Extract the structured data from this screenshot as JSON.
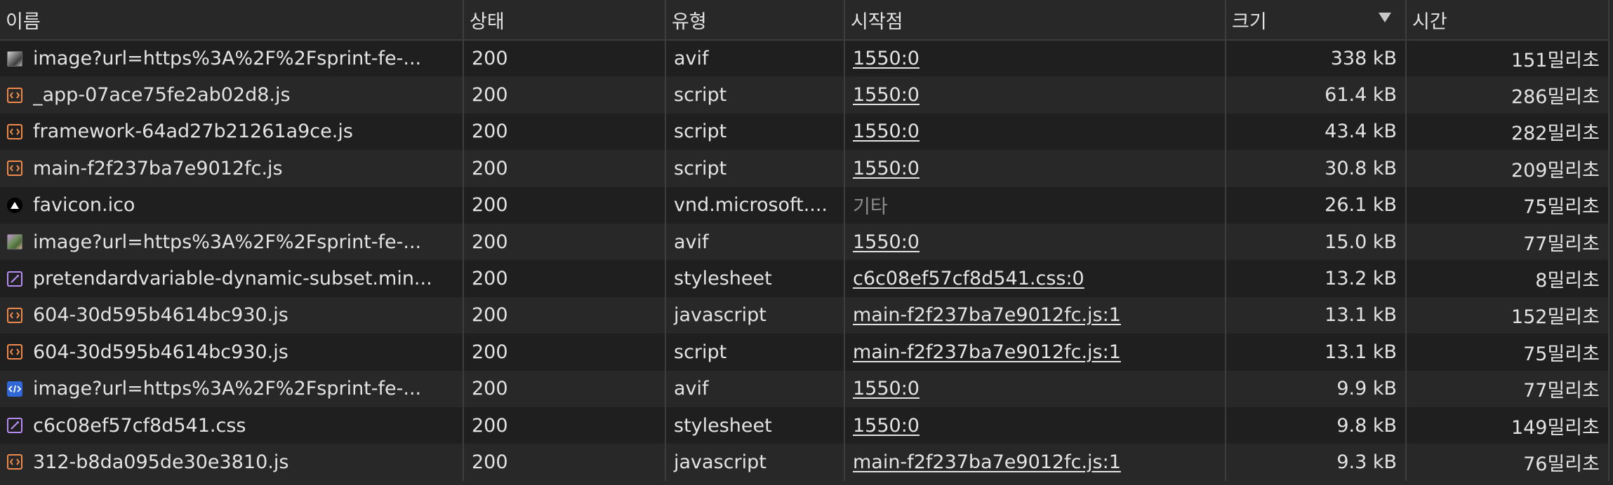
{
  "columns": {
    "name": "이름",
    "status": "상태",
    "type": "유형",
    "initiator": "시작점",
    "size": "크기",
    "time": "시간"
  },
  "sort": {
    "column": "size",
    "direction": "descending"
  },
  "rows": [
    {
      "icon": "image-thumbnail-icon",
      "name": "image?url=https%3A%2F%2Fsprint-fe-...",
      "status": "200",
      "type": "avif",
      "initiator": "1550:0",
      "initiator_link": true,
      "size": "338 kB",
      "time": "151밀리초"
    },
    {
      "icon": "script-file-icon",
      "name": "_app-07ace75fe2ab02d8.js",
      "status": "200",
      "type": "script",
      "initiator": "1550:0",
      "initiator_link": true,
      "size": "61.4 kB",
      "time": "286밀리초"
    },
    {
      "icon": "script-file-icon",
      "name": "framework-64ad27b21261a9ce.js",
      "status": "200",
      "type": "script",
      "initiator": "1550:0",
      "initiator_link": true,
      "size": "43.4 kB",
      "time": "282밀리초"
    },
    {
      "icon": "script-file-icon",
      "name": "main-f2f237ba7e9012fc.js",
      "status": "200",
      "type": "script",
      "initiator": "1550:0",
      "initiator_link": true,
      "size": "30.8 kB",
      "time": "209밀리초"
    },
    {
      "icon": "favicon-icon",
      "name": "favicon.ico",
      "status": "200",
      "type": "vnd.microsoft....",
      "initiator": "기타",
      "initiator_link": false,
      "size": "26.1 kB",
      "time": "75밀리초"
    },
    {
      "icon": "image-thumbnail-icon",
      "name": "image?url=https%3A%2F%2Fsprint-fe-...",
      "status": "200",
      "type": "avif",
      "initiator": "1550:0",
      "initiator_link": true,
      "size": "15.0 kB",
      "time": "77밀리초"
    },
    {
      "icon": "stylesheet-file-icon",
      "name": "pretendardvariable-dynamic-subset.min...",
      "status": "200",
      "type": "stylesheet",
      "initiator": "c6c08ef57cf8d541.css:0",
      "initiator_link": true,
      "size": "13.2 kB",
      "time": "8밀리초"
    },
    {
      "icon": "script-file-icon",
      "name": "604-30d595b4614bc930.js",
      "status": "200",
      "type": "javascript",
      "initiator": "main-f2f237ba7e9012fc.js:1",
      "initiator_link": true,
      "size": "13.1 kB",
      "time": "152밀리초"
    },
    {
      "icon": "script-file-icon",
      "name": "604-30d595b4614bc930.js",
      "status": "200",
      "type": "script",
      "initiator": "main-f2f237ba7e9012fc.js:1",
      "initiator_link": true,
      "size": "13.1 kB",
      "time": "75밀리초"
    },
    {
      "icon": "code-image-icon",
      "name": "image?url=https%3A%2F%2Fsprint-fe-...",
      "status": "200",
      "type": "avif",
      "initiator": "1550:0",
      "initiator_link": true,
      "size": "9.9 kB",
      "time": "77밀리초"
    },
    {
      "icon": "stylesheet-file-icon",
      "name": "c6c08ef57cf8d541.css",
      "status": "200",
      "type": "stylesheet",
      "initiator": "1550:0",
      "initiator_link": true,
      "size": "9.8 kB",
      "time": "149밀리초"
    },
    {
      "icon": "script-file-icon",
      "name": "312-b8da095de30e3810.js",
      "status": "200",
      "type": "javascript",
      "initiator": "main-f2f237ba7e9012fc.js:1",
      "initiator_link": true,
      "size": "9.3 kB",
      "time": "76밀리초"
    }
  ],
  "colors": {
    "background": "#282828",
    "row_alt": "#1f1f1f",
    "script_icon": "#f08a4b",
    "stylesheet_icon": "#b48cf2",
    "muted_text": "#8c8c8c"
  }
}
